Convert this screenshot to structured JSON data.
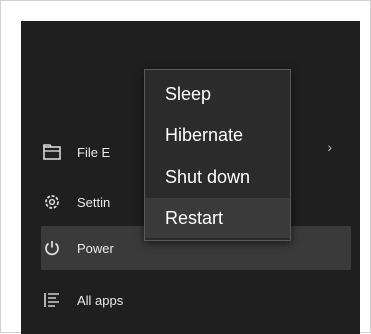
{
  "start_menu": {
    "items": [
      {
        "label": "File E",
        "icon": "file-explorer-icon"
      },
      {
        "label": "Settin",
        "icon": "gear-icon"
      },
      {
        "label": "Power",
        "icon": "power-icon"
      },
      {
        "label": "All apps",
        "icon": "list-icon"
      }
    ],
    "chevron": "›"
  },
  "power_menu": {
    "options": [
      "Sleep",
      "Hibernate",
      "Shut down",
      "Restart"
    ]
  },
  "colors": {
    "panel_bg": "#1f1f1f",
    "menu_bg": "#2b2b2b",
    "highlight": "#3a3a3a"
  }
}
